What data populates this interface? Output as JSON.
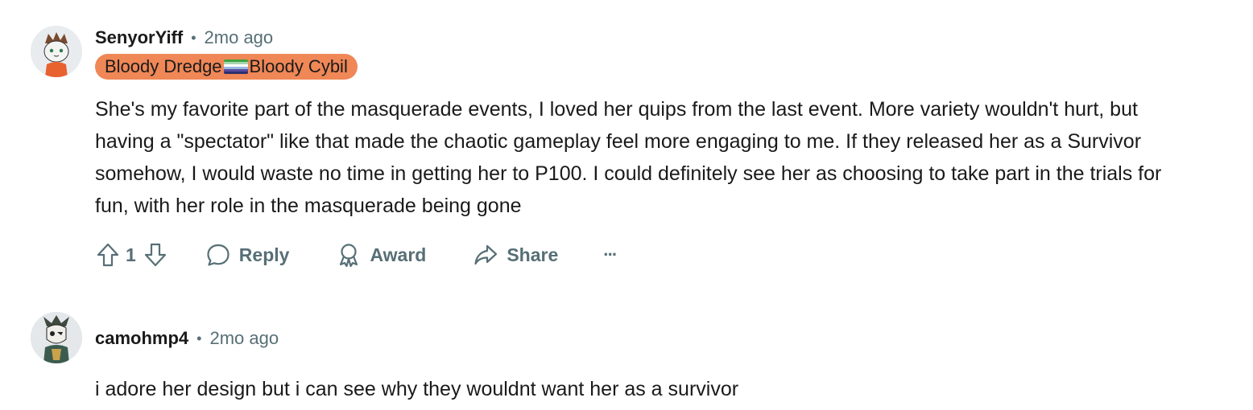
{
  "comments": [
    {
      "username": "SenyorYiff",
      "separator": "•",
      "time": "2mo ago",
      "flair": {
        "left": "Bloody Dredge",
        "right": "Bloody Cybil",
        "icon": "flag-icon"
      },
      "body": "She's my favorite part of the masquerade events, I loved her quips from the last event. More variety wouldn't hurt, but having a \"spectator\" like that made the chaotic gameplay feel more engaging to me. If they released her as a Survivor somehow, I would waste no time in getting her to P100. I could definitely see her as choosing to take part in the trials for fun, with her role in the masquerade being gone",
      "actions": {
        "vote_count": "1",
        "reply": "Reply",
        "award": "Award",
        "share": "Share",
        "more": "···"
      }
    },
    {
      "username": "camohmp4",
      "separator": "•",
      "time": "2mo ago",
      "body": "i adore her design but i can see why they wouldnt want her as a survivor"
    }
  ],
  "colors": {
    "flair_bg": "#ef8756",
    "meta_gray": "#576f76",
    "text": "#1a1a1b"
  }
}
